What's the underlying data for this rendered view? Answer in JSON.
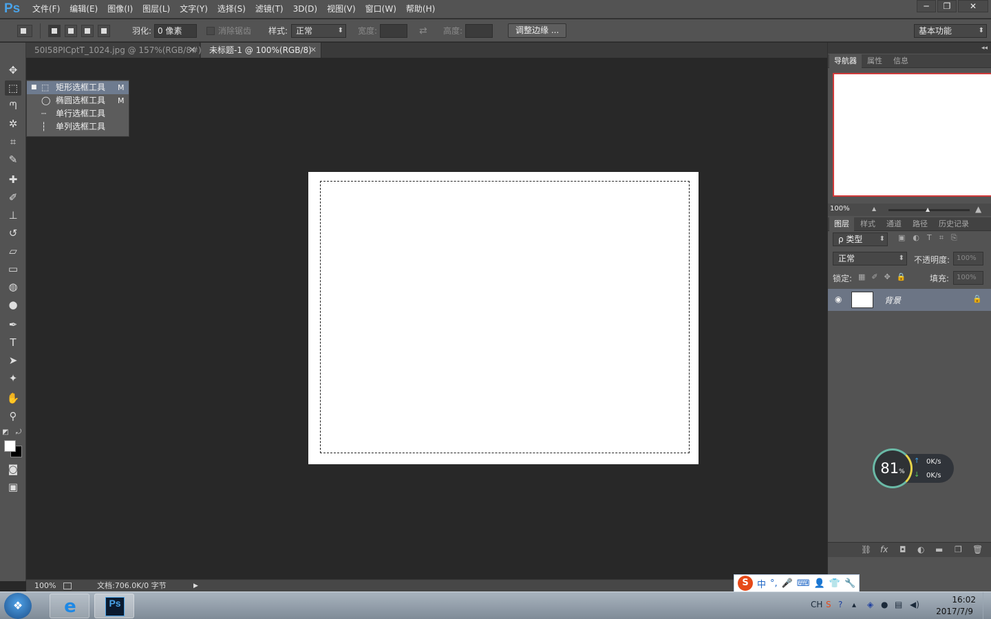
{
  "app": {
    "logo": "Ps",
    "menus": [
      "文件(F)",
      "编辑(E)",
      "图像(I)",
      "图层(L)",
      "文字(Y)",
      "选择(S)",
      "滤镜(T)",
      "3D(D)",
      "视图(V)",
      "窗口(W)",
      "帮助(H)"
    ],
    "window_controls": {
      "minimize": "─",
      "restore": "❐",
      "close": "✕"
    }
  },
  "options_bar": {
    "feather_label": "羽化:",
    "feather_value": "0 像素",
    "antialias_label": "消除锯齿",
    "style_label": "样式:",
    "style_value": "正常",
    "width_label": "宽度:",
    "height_label": "高度:",
    "swap_icon": "⇄",
    "refine_edge_button": "调整边缘 ...",
    "workspace_value": "基本功能"
  },
  "tabs": [
    {
      "label": "50I58PICptT_1024.jpg @ 157%(RGB/8#)",
      "active": false
    },
    {
      "label": "未标题-1 @ 100%(RGB/8)",
      "active": true
    }
  ],
  "tab_close": "✕",
  "tools": [
    {
      "name": "move-tool",
      "icon": "✥"
    },
    {
      "name": "marquee-tool",
      "icon": "⬚"
    },
    {
      "name": "lasso-tool",
      "icon": "ᘉ"
    },
    {
      "name": "magic-wand-tool",
      "icon": "✲"
    },
    {
      "name": "crop-tool",
      "icon": "⌗"
    },
    {
      "name": "eyedropper-tool",
      "icon": "✎"
    },
    {
      "name": "healing-brush-tool",
      "icon": "✚"
    },
    {
      "name": "brush-tool",
      "icon": "✐"
    },
    {
      "name": "clone-stamp-tool",
      "icon": "⊥"
    },
    {
      "name": "history-brush-tool",
      "icon": "↺"
    },
    {
      "name": "eraser-tool",
      "icon": "▱"
    },
    {
      "name": "gradient-tool",
      "icon": "▭"
    },
    {
      "name": "blur-tool",
      "icon": "◍"
    },
    {
      "name": "dodge-tool",
      "icon": "●"
    },
    {
      "name": "pen-tool",
      "icon": "✒"
    },
    {
      "name": "type-tool",
      "icon": "T"
    },
    {
      "name": "path-selection-tool",
      "icon": "➤"
    },
    {
      "name": "custom-shape-tool",
      "icon": "✦"
    },
    {
      "name": "hand-tool",
      "icon": "✋"
    },
    {
      "name": "zoom-tool",
      "icon": "⚲"
    }
  ],
  "tool_extras": {
    "default_colors": "◩",
    "swap_colors": "⤾",
    "quick_mask": "◙",
    "screen_mode": "▣"
  },
  "colors": {
    "foreground": "#ffffff",
    "background": "#000000",
    "accent_selected_layer": "#6c7585",
    "ps_blue": "#4aa3e8"
  },
  "flyout": [
    {
      "icon": "⬚",
      "label": "矩形选框工具",
      "key": "M",
      "selected": true,
      "bullet": "■"
    },
    {
      "icon": "◯",
      "label": "椭圆选框工具",
      "key": "M",
      "selected": false,
      "bullet": ""
    },
    {
      "icon": "┄",
      "label": "单行选框工具",
      "key": "",
      "selected": false,
      "bullet": ""
    },
    {
      "icon": "┆",
      "label": "单列选框工具",
      "key": "",
      "selected": false,
      "bullet": ""
    }
  ],
  "statusbar": {
    "zoom": "100%",
    "doc_info": "文档:706.0K/0 字节",
    "arrow": "▶"
  },
  "navigator": {
    "tabs": [
      "导航器",
      "属性",
      "信息"
    ],
    "zoom": "100%",
    "zoom_out_icon": "▲",
    "zoom_in_icon": "▲"
  },
  "layers_panel": {
    "tabs": [
      "图层",
      "样式",
      "通道",
      "路径",
      "历史记录"
    ],
    "filter_kind": "ρ 类型",
    "blend_mode": "正常",
    "opacity_label": "不透明度:",
    "opacity_value": "100%",
    "lock_label": "锁定:",
    "fill_label": "填充:",
    "fill_value": "100%",
    "layer_name": "背景",
    "eye_icon": "◉",
    "lock_icon": "🔒",
    "footer_icons": [
      "⛓",
      "fx",
      "◘",
      "◐",
      "▬",
      "❐",
      "🗑"
    ]
  },
  "speed_widget": {
    "percent": "81",
    "percent_sign": "%",
    "up": "0K/s",
    "down": "0K/s",
    "up_arrow": "↑",
    "down_arrow": "↓"
  },
  "ime_bar": {
    "logo": "S",
    "items": [
      "中",
      "°,",
      "🎤",
      "⌨",
      "👤",
      "👕",
      "🔧"
    ]
  },
  "taskbar": {
    "start_icon": "❖",
    "ie_icon": "e",
    "ps_icon": "Ps",
    "tray": {
      "lang": "CH",
      "time": "16:02",
      "date": "2017/7/9"
    }
  }
}
